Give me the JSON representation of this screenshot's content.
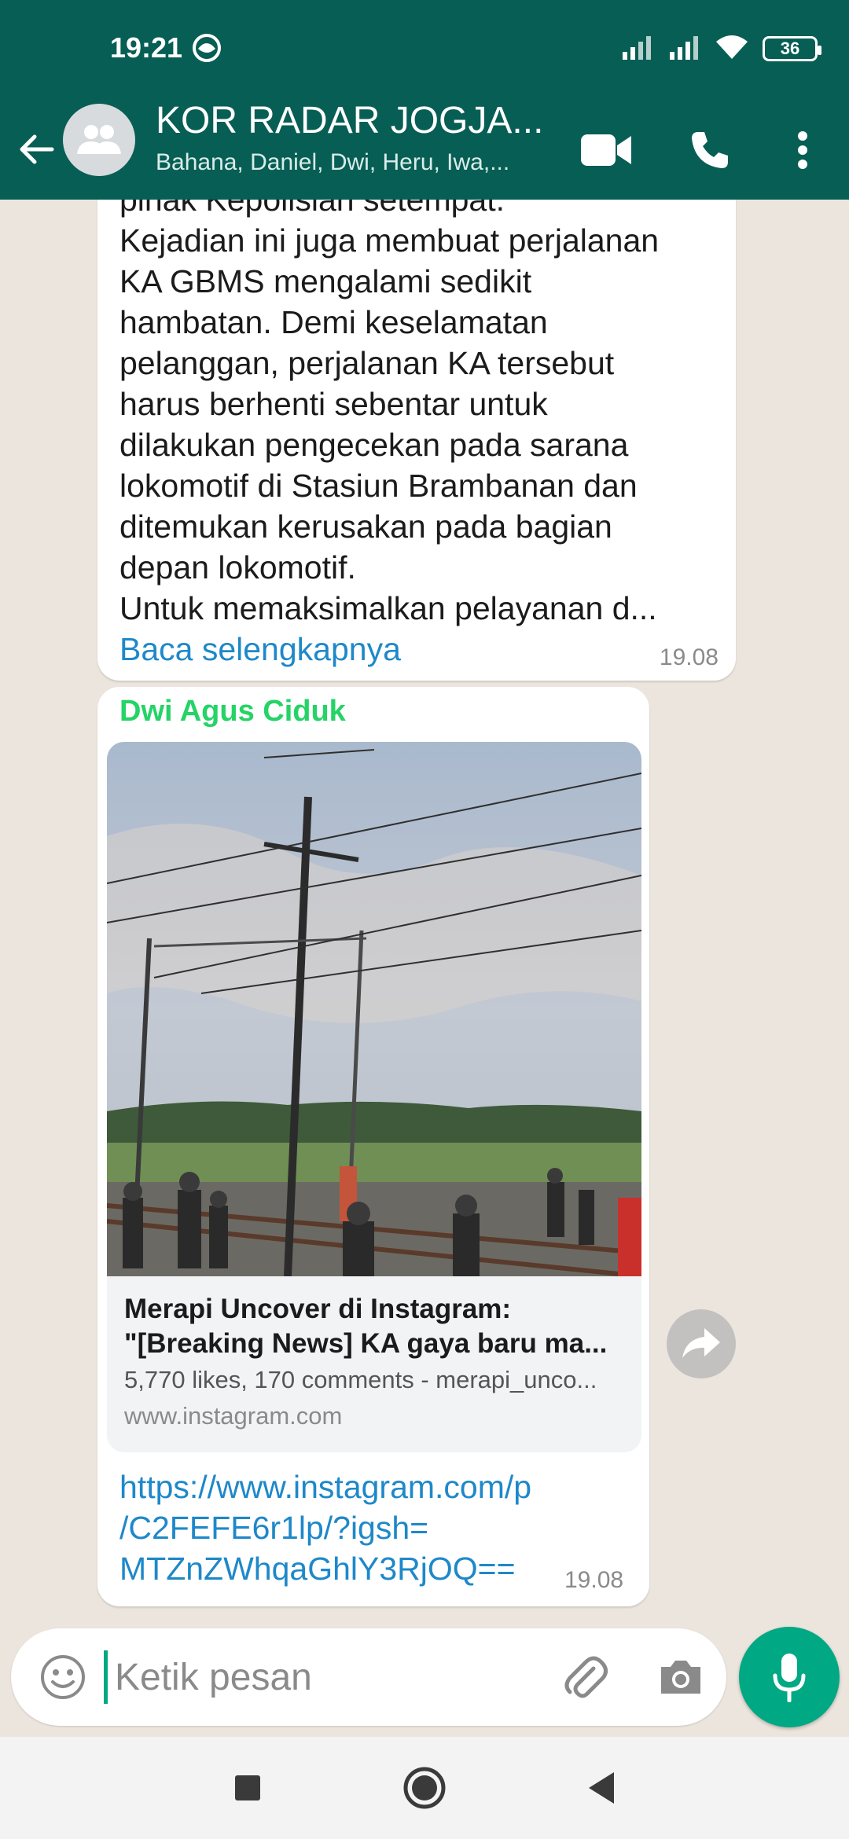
{
  "status_bar": {
    "time": "19:21",
    "battery": "36"
  },
  "header": {
    "title": "KOR RADAR JOGJA...",
    "subtitle": "Bahana, Daniel, Dwi, Heru, Iwa,..."
  },
  "messages": [
    {
      "lines": [
        "pihak Kepolisian setempat.",
        "Kejadian ini juga membuat perjalanan",
        "KA GBMS mengalami sedikit",
        "hambatan. Demi keselamatan",
        "pelanggan, perjalanan KA tersebut",
        "harus berhenti sebentar untuk",
        "dilakukan pengecekan pada sarana",
        "lokomotif di Stasiun Brambanan dan",
        "ditemukan kerusakan pada bagian",
        "depan lokomotif.",
        "Untuk memaksimalkan pelayanan d..."
      ],
      "read_more": "Baca selengkapnya",
      "time": "19.08"
    },
    {
      "sender": "Dwi Agus Ciduk",
      "preview": {
        "title": "Merapi Uncover di Instagram:",
        "title2": "\"[Breaking News] KA gaya baru ma...",
        "description": "5,770 likes, 170 comments - merapi_unco...",
        "domain": "www.instagram.com"
      },
      "link_lines": [
        "https://www.instagram.com/p",
        "/C2FEFE6r1lp/?igsh=",
        "MTZnZWhqaGhlY3RjOQ=="
      ],
      "time": "19.08"
    }
  ],
  "composer": {
    "placeholder": "Ketik pesan"
  },
  "colors": {
    "header": "#075E54",
    "accent": "#00A884",
    "sender": "#25D366",
    "link": "#1E88C9",
    "wallpaper": "#ECE5DD"
  }
}
